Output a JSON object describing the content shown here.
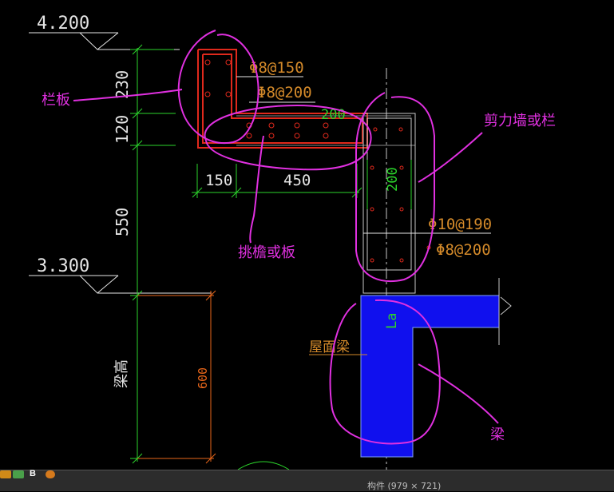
{
  "elevations": {
    "top": "4.200",
    "bottom": "3.300"
  },
  "dimensions": {
    "d230": "230",
    "d120": "120",
    "d550": "550",
    "d150": "150",
    "d450": "450",
    "d200_top": "200",
    "d200_wall": "200",
    "d600": "600"
  },
  "rebar": {
    "r1": "Φ8@150",
    "r2": "Φ8@200",
    "r3": "Φ10@190",
    "r4": "Φ8@200"
  },
  "labels": {
    "la": "La",
    "roof_beam": "屋面梁",
    "beam_height": "梁高"
  },
  "annotations": {
    "railing": "栏板",
    "eave": "挑檐或板",
    "shear_wall": "剪力墙或栏",
    "beam": "梁"
  },
  "status": {
    "caption": "构件 (979 × 721)"
  },
  "colors": {
    "background": "#000000",
    "dimension_line": "#2bd42b",
    "text_white": "#e6e6e6",
    "rebar_text": "#d48a2a",
    "structure_red": "#e0291c",
    "concrete_outline": "#c9c9c9",
    "beam_fill": "#1010ee",
    "annotation_magenta": "#e030e0",
    "beam_height_line": "#e8661a"
  }
}
